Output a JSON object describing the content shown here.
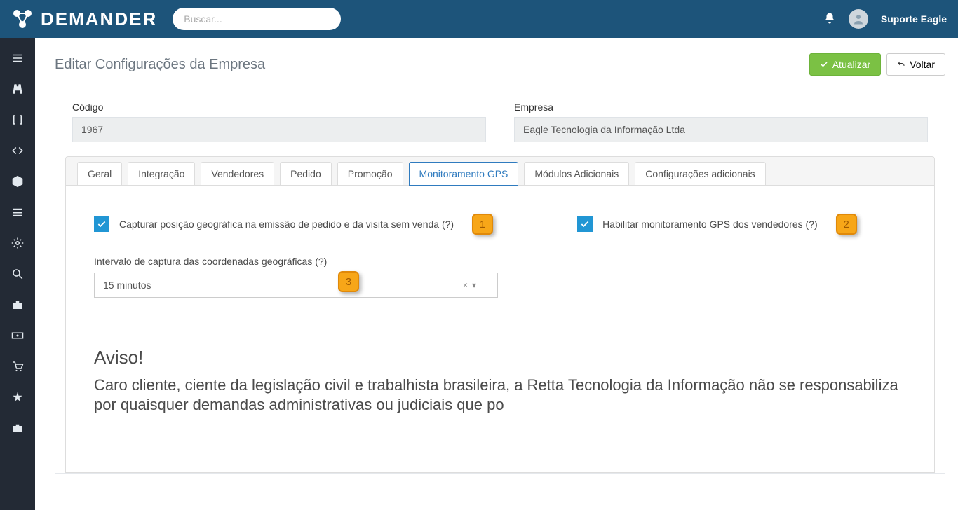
{
  "topbar": {
    "brand": "DEMANDER",
    "search_placeholder": "Buscar...",
    "username": "Suporte Eagle"
  },
  "sidebar": {
    "items": [
      {
        "name": "menu"
      },
      {
        "name": "road"
      },
      {
        "name": "brackets"
      },
      {
        "name": "code"
      },
      {
        "name": "package"
      },
      {
        "name": "list"
      },
      {
        "name": "cog"
      },
      {
        "name": "search"
      },
      {
        "name": "briefcase"
      },
      {
        "name": "cash"
      },
      {
        "name": "cart"
      },
      {
        "name": "star"
      },
      {
        "name": "briefcase2"
      }
    ]
  },
  "page": {
    "title": "Editar Configurações da Empresa",
    "btn_update": "Atualizar",
    "btn_back": "Voltar",
    "code_label": "Código",
    "code_value": "1967",
    "company_label": "Empresa",
    "company_value": "Eagle Tecnologia da Informação Ltda"
  },
  "tabs": [
    {
      "label": "Geral"
    },
    {
      "label": "Integração"
    },
    {
      "label": "Vendedores"
    },
    {
      "label": "Pedido"
    },
    {
      "label": "Promoção"
    },
    {
      "label": "Monitoramento GPS",
      "active": true
    },
    {
      "label": "Módulos Adicionais"
    },
    {
      "label": "Configurações adicionais"
    }
  ],
  "gps": {
    "check1_label": "Capturar posição geográfica na emissão de pedido e da visita sem venda (?)",
    "check2_label": "Habilitar monitoramento GPS dos vendedores (?)",
    "interval_label": "Intervalo de captura das coordenadas geográficas (?)",
    "interval_value": "15 minutos",
    "clear": "×",
    "annot1": "1",
    "annot2": "2",
    "annot3": "3",
    "aviso_title": "Aviso!",
    "aviso_body": "Caro cliente, ciente da legislação civil e trabalhista brasileira, a Retta Tecnologia da Informação não se responsabiliza por quaisquer demandas administrativas ou judiciais que po"
  }
}
